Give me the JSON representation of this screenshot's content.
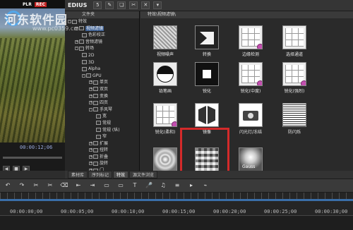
{
  "player": {
    "badge_plr": "PLR",
    "badge_rec": "REC",
    "timecode": "00:00:12;06",
    "controls": [
      "◀",
      "■",
      "▶"
    ]
  },
  "app": {
    "title": "EDIUS",
    "toolbar_icons": [
      "folder-icon",
      "copy-icon",
      "cut-icon",
      "delete-icon",
      "menu-icon"
    ],
    "toolbar_glyphs": [
      "5",
      "✎",
      "❏",
      "✂",
      "✕",
      "▾"
    ]
  },
  "tree": {
    "header": "文件夹",
    "items": [
      {
        "label": "特效",
        "depth": 0,
        "expand": "-"
      },
      {
        "label": "视频滤镜",
        "depth": 1,
        "expand": "+",
        "selected": true
      },
      {
        "label": "色彩校正",
        "depth": 2,
        "expand": ""
      },
      {
        "label": "音频滤镜",
        "depth": 1,
        "expand": "+"
      },
      {
        "label": "转场",
        "depth": 1,
        "expand": "-"
      },
      {
        "label": "2D",
        "depth": 2,
        "expand": ""
      },
      {
        "label": "3D",
        "depth": 2,
        "expand": ""
      },
      {
        "label": "Alpha",
        "depth": 2,
        "expand": ""
      },
      {
        "label": "GPU",
        "depth": 2,
        "expand": "-"
      },
      {
        "label": "单页",
        "depth": 3,
        "expand": "+"
      },
      {
        "label": "双页",
        "depth": 3,
        "expand": "+"
      },
      {
        "label": "变换",
        "depth": 3,
        "expand": "+"
      },
      {
        "label": "四页",
        "depth": 3,
        "expand": "+"
      },
      {
        "label": "手风琴",
        "depth": 3,
        "expand": "-"
      },
      {
        "label": "宽",
        "depth": 4,
        "expand": ""
      },
      {
        "label": "常规",
        "depth": 4,
        "expand": ""
      },
      {
        "label": "常规 (纵)",
        "depth": 4,
        "expand": ""
      },
      {
        "label": "窄",
        "depth": 4,
        "expand": ""
      },
      {
        "label": "扩展",
        "depth": 3,
        "expand": "+"
      },
      {
        "label": "扭转",
        "depth": 3,
        "expand": "+"
      },
      {
        "label": "折叠",
        "depth": 3,
        "expand": "+"
      },
      {
        "label": "旋转",
        "depth": 3,
        "expand": "+"
      },
      {
        "label": "门",
        "depth": 3,
        "expand": "+"
      }
    ]
  },
  "effects": {
    "path": "特效\\视频滤镜\\",
    "items": [
      {
        "label": "视频噪声",
        "thumb": "noise"
      },
      {
        "label": "转换",
        "thumb": "dark"
      },
      {
        "label": "边缘检测",
        "thumb": "grid-pink"
      },
      {
        "label": "选择通道",
        "thumb": "grid"
      },
      {
        "label": "铅笔画",
        "thumb": "half"
      },
      {
        "label": "锐化",
        "thumb": "dark-square"
      },
      {
        "label": "锐化(中度)",
        "thumb": "grid-pink"
      },
      {
        "label": "锐化(强烈)",
        "thumb": "grid-pink"
      },
      {
        "label": "锐化(柔和)",
        "thumb": "grid-pink"
      },
      {
        "label": "镜像",
        "thumb": "mirror"
      },
      {
        "label": "闪光灯/冻结",
        "thumb": "camera"
      },
      {
        "label": "防闪烁",
        "thumb": "lines"
      },
      {
        "label": "隧道视觉",
        "thumb": "rings"
      },
      {
        "label": "马赛克",
        "thumb": "mosaic"
      },
      {
        "label": "高斯模糊",
        "thumb": "gauss",
        "caption": "Gauss"
      }
    ]
  },
  "tabs": [
    "素材库",
    "序列标记",
    "特效",
    "源文件浏览"
  ],
  "active_tab": 2,
  "bottom_toolbar": [
    "↶",
    "↷",
    "✂",
    "✂",
    "⌫",
    "⇤",
    "⇥",
    "▭",
    "▭",
    "T",
    "🎤",
    "♫",
    "≡",
    "▸",
    "⌁"
  ],
  "timeline": {
    "timecodes": [
      "00:00:00;00",
      "00:00:05;00",
      "00:00:10;00",
      "00:00:15;00",
      "00:00:20;00",
      "00:00:25;00",
      "00:00:30;00"
    ]
  },
  "watermark": {
    "text": "河东软件园",
    "url": "www.pc0359.cn"
  }
}
